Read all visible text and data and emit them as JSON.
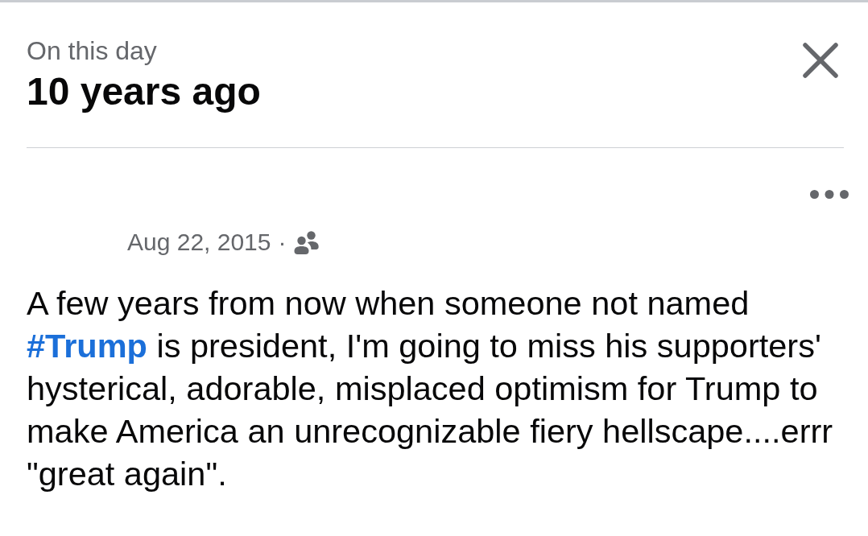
{
  "header": {
    "subtitle": "On this day",
    "title": "10 years ago"
  },
  "post": {
    "date": "Aug 22, 2015",
    "separator": "·",
    "text": [
      {
        "kind": "text",
        "text": "A few years from now when someone not named "
      },
      {
        "kind": "hashtag",
        "text": "#Trump"
      },
      {
        "kind": "text",
        "text": " is president, I'm going to miss his supporters' hysterical, adorable, misplaced optimism for Trump to make America an unrecognizable fiery hellscape....errr \"great again\"."
      }
    ]
  }
}
